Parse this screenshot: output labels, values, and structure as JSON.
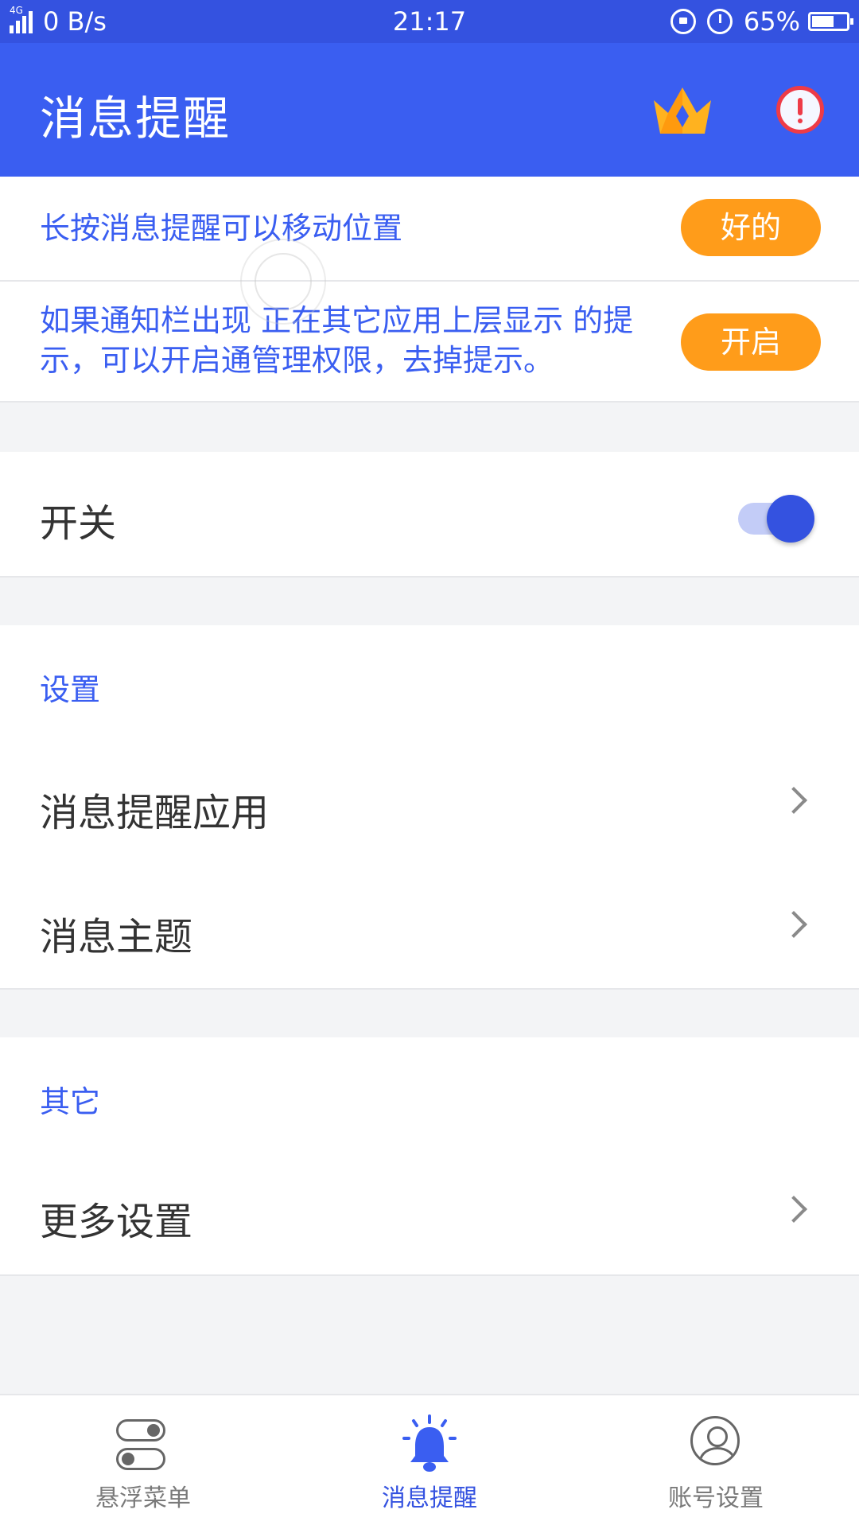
{
  "status_bar": {
    "network_type": "4G",
    "speed": "0 B/s",
    "time": "21:17",
    "battery": "65%",
    "battery_level": 0.65
  },
  "app_bar": {
    "title": "消息提醒"
  },
  "tips": [
    {
      "text": "长按消息提醒可以移动位置",
      "button": "好的"
    },
    {
      "text": "如果通知栏出现 正在其它应用上层显示 的提示，可以开启通管理权限，去掉提示。",
      "button": "开启"
    }
  ],
  "switch_row": {
    "label": "开关",
    "on": true
  },
  "settings": {
    "title": "设置",
    "items": [
      {
        "label": "消息提醒应用"
      },
      {
        "label": "消息主题"
      }
    ]
  },
  "other": {
    "title": "其它",
    "items": [
      {
        "label": "更多设置"
      }
    ]
  },
  "bottom_nav": {
    "items": [
      {
        "label": "悬浮菜单"
      },
      {
        "label": "消息提醒"
      },
      {
        "label": "账号设置"
      }
    ],
    "active_index": 1
  },
  "colors": {
    "status_bar": "#3452e0",
    "app_bar": "#3a5ef1",
    "accent_blue": "#3a5ef1",
    "button_orange": "#ff9c1a",
    "alert_red": "#ee3b47"
  }
}
